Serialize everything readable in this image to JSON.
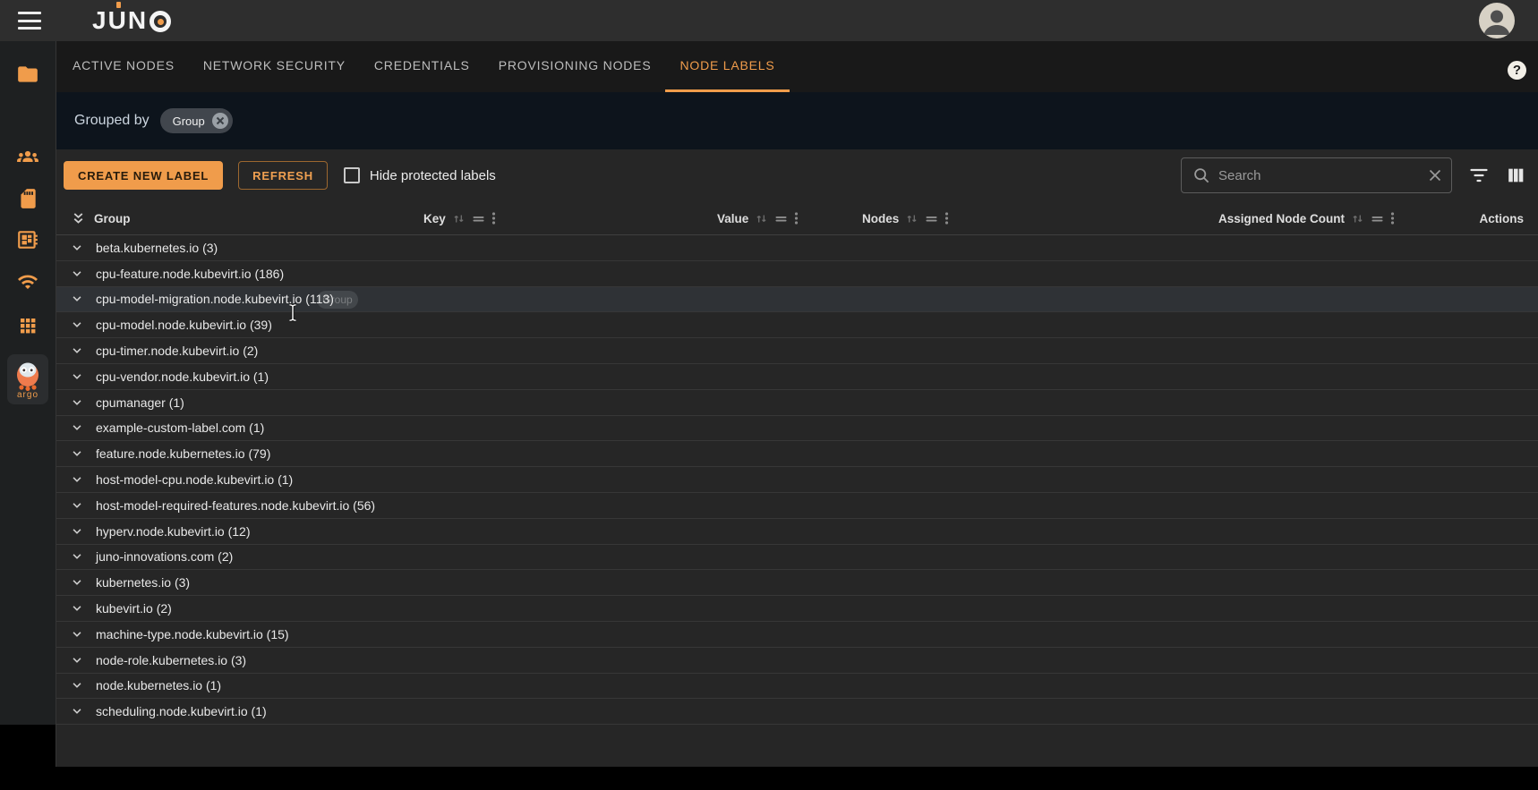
{
  "topbar": {
    "logo_text": "JUNO",
    "menu_icon": "hamburger-menu",
    "avatar_icon": "user-avatar"
  },
  "tabs": [
    {
      "label": "ACTIVE NODES",
      "active": false
    },
    {
      "label": "NETWORK SECURITY",
      "active": false
    },
    {
      "label": "CREDENTIALS",
      "active": false
    },
    {
      "label": "PROVISIONING NODES",
      "active": false
    },
    {
      "label": "NODE LABELS",
      "active": true
    }
  ],
  "help_icon_label": "?",
  "grouped_by": {
    "label": "Grouped by",
    "chip_label": "Group",
    "chip_close_icon": "close"
  },
  "toolbar": {
    "create_button": "CREATE NEW LABEL",
    "refresh_button": "REFRESH",
    "hide_protected_label": "Hide protected labels",
    "hide_protected_checked": false,
    "search_placeholder": "Search"
  },
  "table": {
    "group_column_label": "Group",
    "sortable_columns": [
      "Key",
      "Value",
      "Nodes",
      "Assigned Node Count"
    ],
    "actions_column_label": "Actions",
    "hovered_row_index": 2,
    "hover_ghost_chip": "Group",
    "groups": [
      {
        "label": "beta.kubernetes.io",
        "count": 3
      },
      {
        "label": "cpu-feature.node.kubevirt.io",
        "count": 186
      },
      {
        "label": "cpu-model-migration.node.kubevirt.io",
        "count": 113
      },
      {
        "label": "cpu-model.node.kubevirt.io",
        "count": 39
      },
      {
        "label": "cpu-timer.node.kubevirt.io",
        "count": 2
      },
      {
        "label": "cpu-vendor.node.kubevirt.io",
        "count": 1
      },
      {
        "label": "cpumanager",
        "count": 1
      },
      {
        "label": "example-custom-label.com",
        "count": 1
      },
      {
        "label": "feature.node.kubernetes.io",
        "count": 79
      },
      {
        "label": "host-model-cpu.node.kubevirt.io",
        "count": 1
      },
      {
        "label": "host-model-required-features.node.kubevirt.io",
        "count": 56
      },
      {
        "label": "hyperv.node.kubevirt.io",
        "count": 12
      },
      {
        "label": "juno-innovations.com",
        "count": 2
      },
      {
        "label": "kubernetes.io",
        "count": 3
      },
      {
        "label": "kubevirt.io",
        "count": 2
      },
      {
        "label": "machine-type.node.kubevirt.io",
        "count": 15
      },
      {
        "label": "node-role.kubernetes.io",
        "count": 3
      },
      {
        "label": "node.kubernetes.io",
        "count": 1
      },
      {
        "label": "scheduling.node.kubevirt.io",
        "count": 1
      }
    ]
  },
  "sidebar": {
    "icons": [
      "folder-icon",
      "groups-icon",
      "sim-card-icon",
      "developer-board-icon",
      "wifi-icon",
      "apps-grid-icon",
      "package-icon",
      "argo-logo"
    ],
    "argo_label": "argo"
  },
  "colors": {
    "accent": "#f09c4b",
    "band_bg": "#0d141c",
    "main_bg": "#262626",
    "topbar_bg": "#2e2e2e"
  }
}
